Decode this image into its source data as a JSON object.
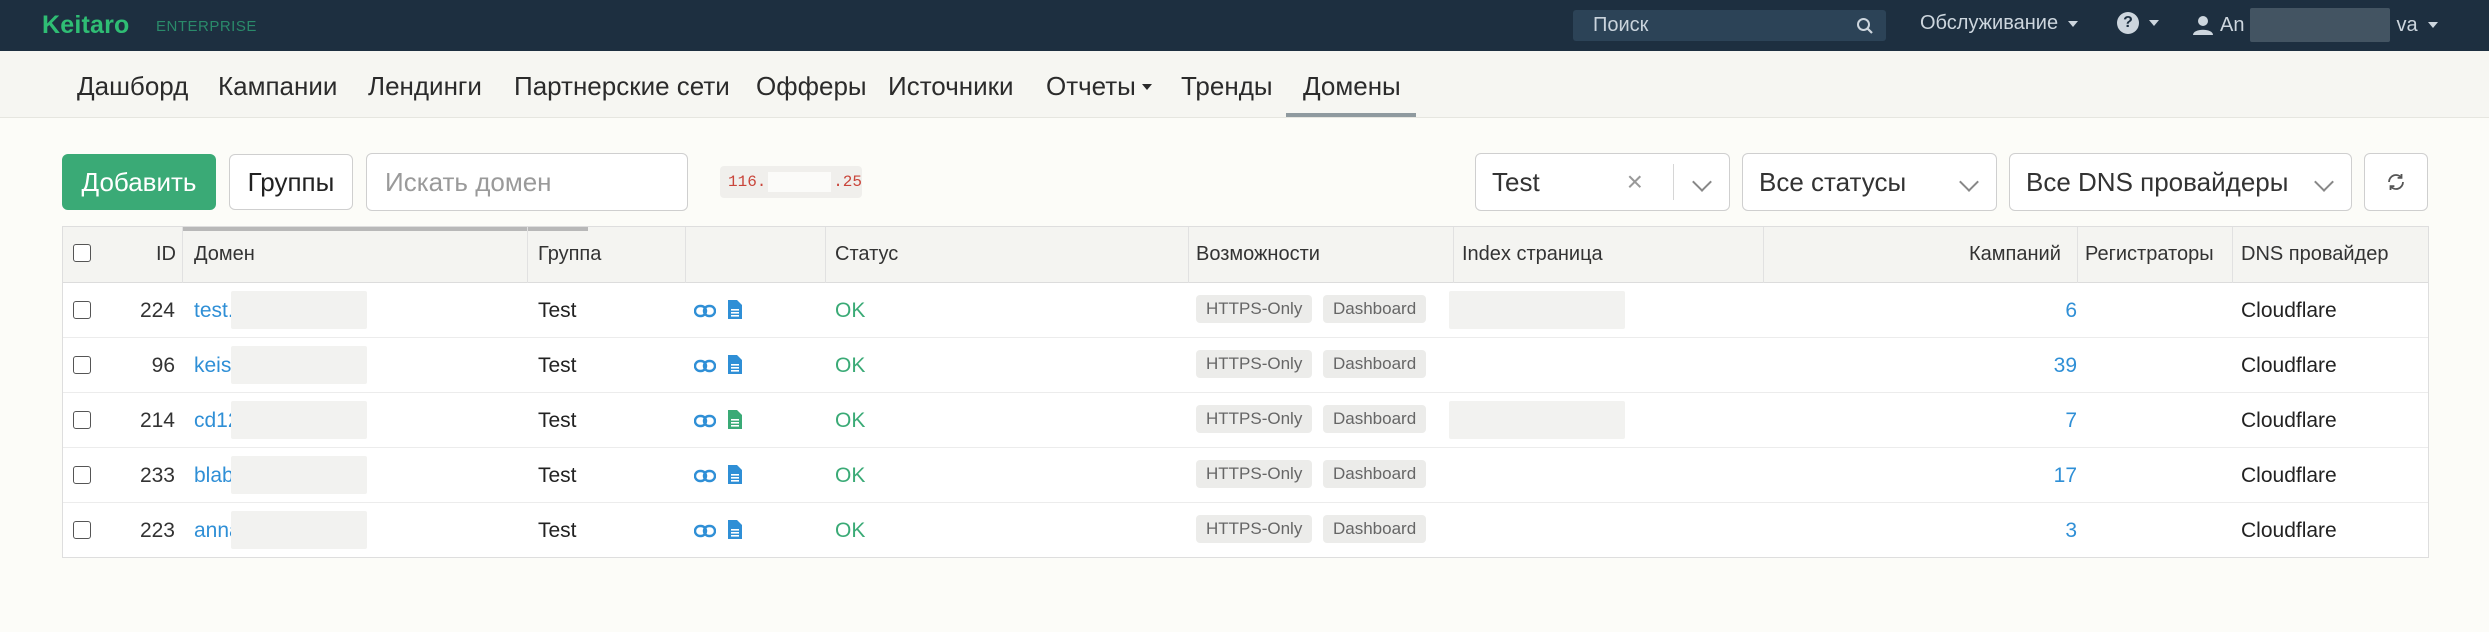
{
  "app": {
    "brand": "Keitaro",
    "edition": "ENTERPRISE"
  },
  "topbar": {
    "search_placeholder": "Поиск",
    "service_label": "Обслуживание",
    "help_label": "?",
    "user_prefix": "An",
    "user_suffix": "va"
  },
  "nav": {
    "items": [
      {
        "label": "Дашборд"
      },
      {
        "label": "Кампании"
      },
      {
        "label": "Лендинги"
      },
      {
        "label": "Партнерские сети"
      },
      {
        "label": "Офферы"
      },
      {
        "label": "Источники"
      },
      {
        "label": "Отчеты"
      },
      {
        "label": "Тренды"
      },
      {
        "label": "Домены"
      }
    ],
    "active": "Домены"
  },
  "toolbar": {
    "add_label": "Добавить",
    "groups_label": "Группы",
    "search_placeholder": "Искать домен",
    "ip_prefix": "116.",
    "ip_suffix": ".25",
    "group_filter": "Test",
    "status_filter": "Все статусы",
    "dns_filter": "Все DNS провайдеры"
  },
  "table": {
    "columns": {
      "id": "ID",
      "domain": "Домен",
      "group": "Группа",
      "status": "Статус",
      "features": "Возможности",
      "index_page": "Index страница",
      "campaigns": "Кампаний",
      "registrars": "Регистраторы",
      "dns": "DNS провайдер"
    },
    "rows": [
      {
        "id": "224",
        "domain": "test.",
        "group": "Test",
        "status": "OK",
        "tag1": "HTTPS-Only",
        "tag2": "Dashboard",
        "campaigns": "6",
        "dns": "Cloudflare"
      },
      {
        "id": "96",
        "domain": "keis",
        "group": "Test",
        "status": "OK",
        "tag1": "HTTPS-Only",
        "tag2": "Dashboard",
        "campaigns": "39",
        "dns": "Cloudflare"
      },
      {
        "id": "214",
        "domain": "cd12",
        "group": "Test",
        "status": "OK",
        "tag1": "HTTPS-Only",
        "tag2": "Dashboard",
        "campaigns": "7",
        "dns": "Cloudflare"
      },
      {
        "id": "233",
        "domain": "blab",
        "group": "Test",
        "status": "OK",
        "tag1": "HTTPS-Only",
        "tag2": "Dashboard",
        "campaigns": "17",
        "dns": "Cloudflare"
      },
      {
        "id": "223",
        "domain": "anna",
        "group": "Test",
        "status": "OK",
        "tag1": "HTTPS-Only",
        "tag2": "Dashboard",
        "campaigns": "3",
        "dns": "Cloudflare"
      }
    ]
  },
  "colors": {
    "topbar_bg": "#1d2f40",
    "brand_green": "#2fbd74",
    "link_blue": "#2f8fd6",
    "ok_green": "#3aaa76",
    "file_green": "#3aaa76"
  }
}
